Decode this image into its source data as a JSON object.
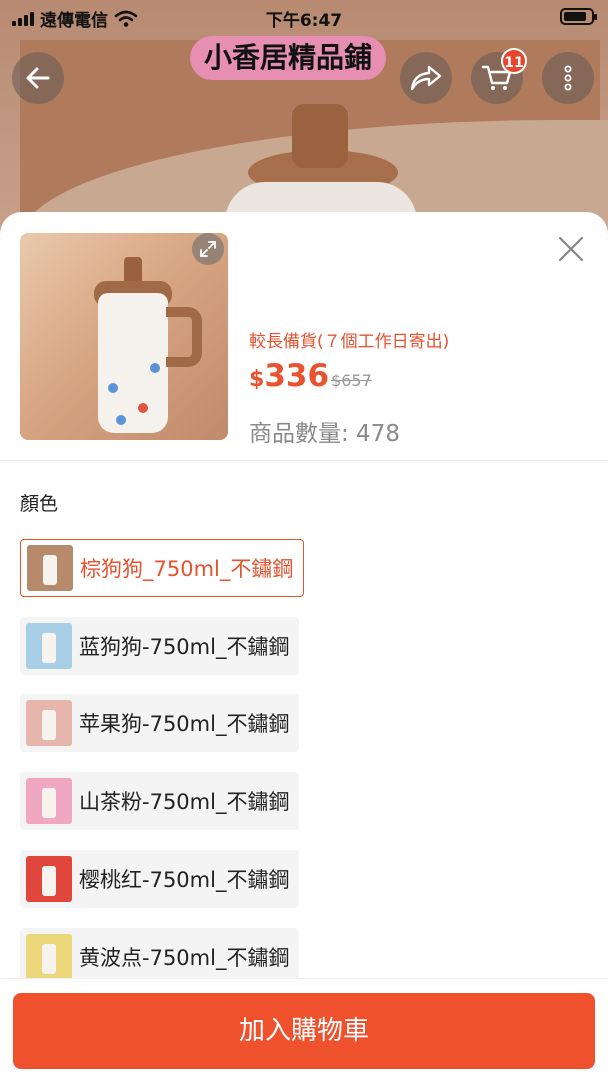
{
  "status": {
    "carrier": "遠傳電信",
    "time": "下午6:47"
  },
  "header": {
    "shop_name": "小香居精品鋪",
    "cart_count": "11"
  },
  "product": {
    "lead_time": "較長備貨(７個工作日寄出)",
    "currency": "$",
    "price": "336",
    "original_price": "$657",
    "stock_text": "商品數量: 478"
  },
  "variants": {
    "label": "顏色",
    "options": [
      {
        "label": "棕狗狗_750ml_不鏽鋼",
        "color": "#b88a6c",
        "selected": true
      },
      {
        "label": "蓝狗狗-750ml_不鏽鋼",
        "color": "#a9cfe6",
        "selected": false
      },
      {
        "label": "苹果狗-750ml_不鏽鋼",
        "color": "#e6b6ad",
        "selected": false
      },
      {
        "label": "山茶粉-750ml_不鏽鋼",
        "color": "#f0a7c1",
        "selected": false
      },
      {
        "label": "樱桃红-750ml_不鏽鋼",
        "color": "#e0463b",
        "selected": false
      },
      {
        "label": "黄波点-750ml_不鏽鋼",
        "color": "#ecd77b",
        "selected": false
      }
    ]
  },
  "actions": {
    "add_to_cart": "加入購物車"
  },
  "colors": {
    "accent": "#ef512d",
    "price": "#e8522e"
  }
}
